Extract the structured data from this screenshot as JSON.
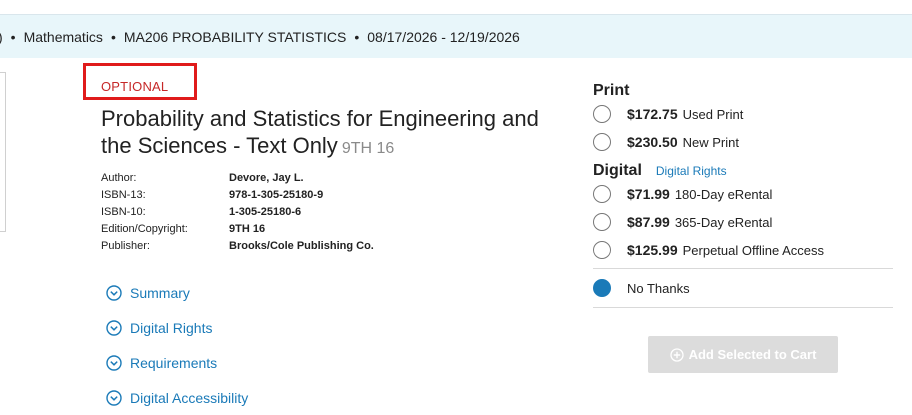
{
  "course_bar": {
    "lead": ")",
    "department": "Mathematics",
    "course": "MA206 PROBABILITY STATISTICS",
    "term": "08/17/2026 - 12/19/2026",
    "separator": "•"
  },
  "book": {
    "requirement": "OPTIONAL",
    "title": "Probability and Statistics for Engineering and the Sciences - Text Only",
    "edition_tag": "9TH 16",
    "details": [
      {
        "label": "Author:",
        "value": "Devore, Jay L."
      },
      {
        "label": "ISBN-13:",
        "value": "978-1-305-25180-9"
      },
      {
        "label": "ISBN-10:",
        "value": "1-305-25180-6"
      },
      {
        "label": "Edition/Copyright:",
        "value": "9TH 16"
      },
      {
        "label": "Publisher:",
        "value": "Brooks/Cole Publishing Co."
      }
    ]
  },
  "expand_links": [
    {
      "label": "Summary",
      "icon": "chevron-down-circle-icon"
    },
    {
      "label": "Digital Rights",
      "icon": "chevron-down-circle-icon"
    },
    {
      "label": "Requirements",
      "icon": "chevron-down-circle-icon"
    },
    {
      "label": "Digital Accessibility",
      "icon": "chevron-down-circle-icon"
    }
  ],
  "purchase": {
    "print_heading": "Print",
    "print_options": [
      {
        "price": "$172.75",
        "label": "Used Print",
        "selected": false
      },
      {
        "price": "$230.50",
        "label": "New Print",
        "selected": false
      }
    ],
    "digital_heading": "Digital",
    "digital_rights_link": "Digital Rights",
    "digital_options": [
      {
        "price": "$71.99",
        "label": "180-Day eRental",
        "selected": false
      },
      {
        "price": "$87.99",
        "label": "365-Day eRental",
        "selected": false
      },
      {
        "price": "$125.99",
        "label": "Perpetual Offline Access",
        "selected": false
      }
    ],
    "no_thanks_label": "No Thanks",
    "no_thanks_selected": true,
    "add_button_label": "Add Selected to Cart"
  },
  "colors": {
    "accent": "#1a7ab8",
    "required_red": "#c62828",
    "highlight_box": "#e01b1b",
    "course_bar_bg": "#e8f6fa",
    "disabled_button": "#dcdcdc"
  }
}
